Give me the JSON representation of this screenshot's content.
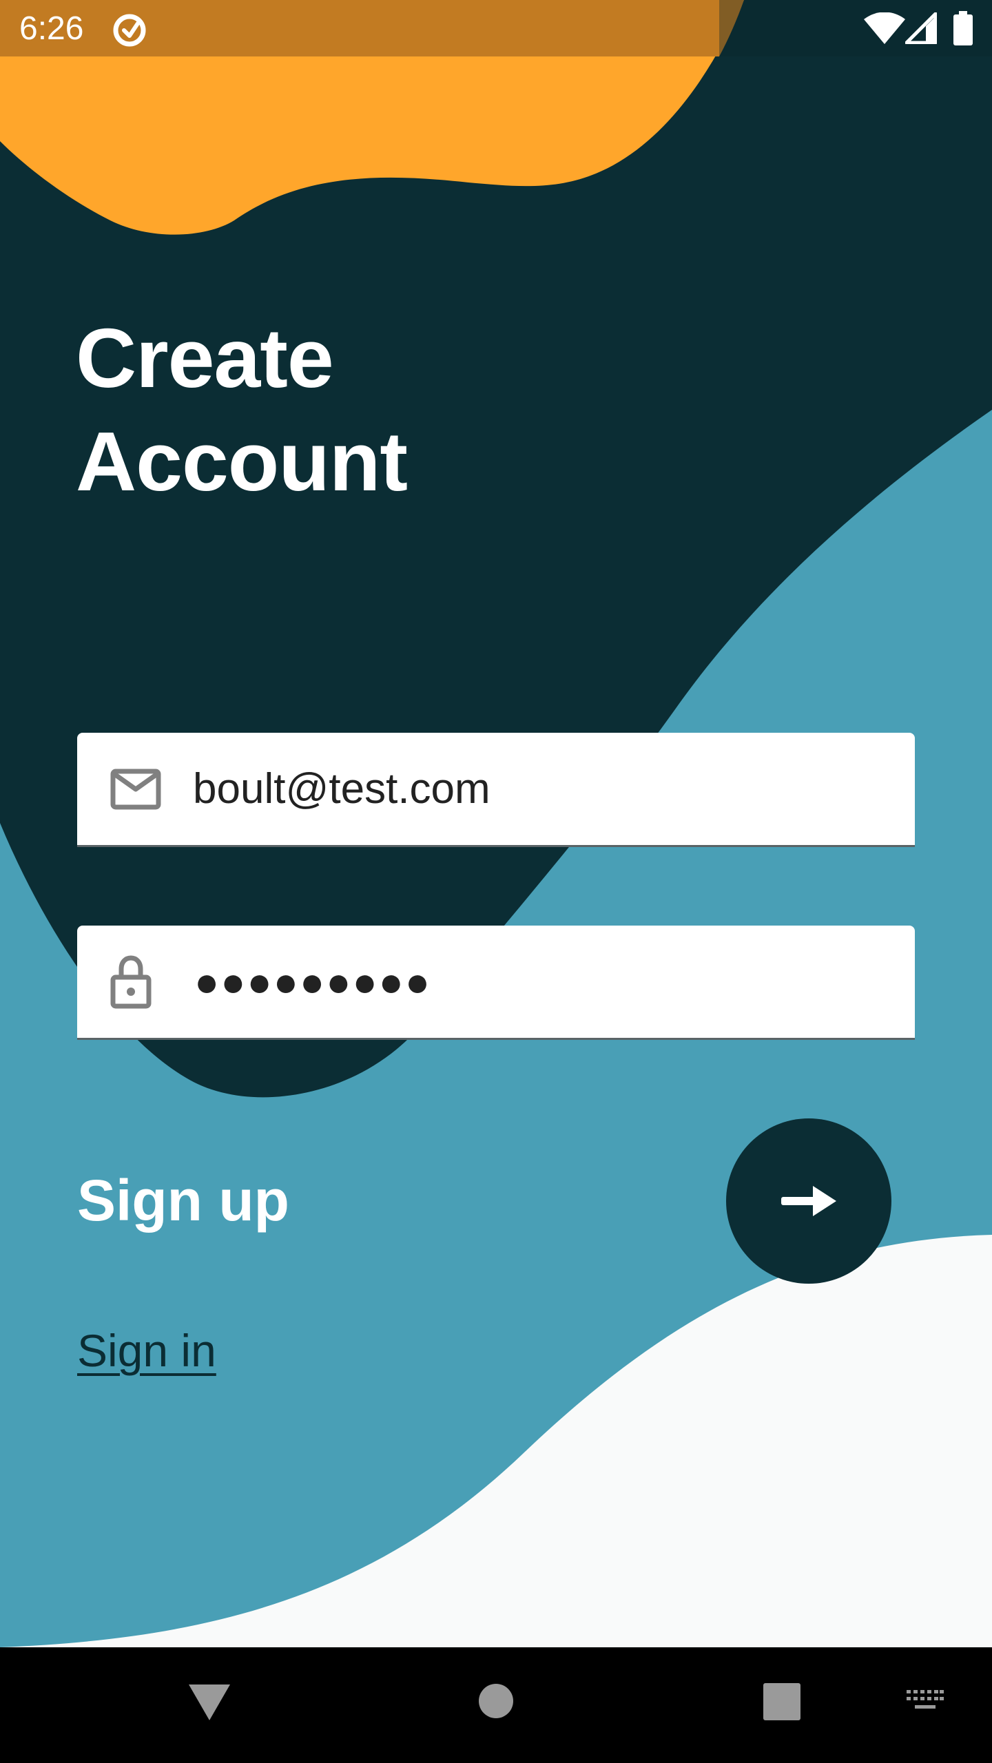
{
  "status_bar": {
    "time": "6:26",
    "icons": [
      "data-saver-icon",
      "wifi-icon",
      "signal-icon",
      "battery-icon"
    ]
  },
  "title": {
    "line1": "Create",
    "line2": "Account"
  },
  "form": {
    "email": {
      "icon": "mail-icon",
      "value": "boult@test.com"
    },
    "password": {
      "icon": "lock-icon",
      "masked_value": "●●●●●●●●●"
    }
  },
  "signup": {
    "label": "Sign up",
    "submit_icon": "arrow-right-icon"
  },
  "signin": {
    "label": "Sign in"
  },
  "nav_bar": {
    "buttons": [
      "back-icon",
      "home-icon",
      "recents-icon",
      "keyboard-icon"
    ]
  },
  "colors": {
    "dark_teal": "#0b2d34",
    "orange": "#ffa62b",
    "status_orange": "#c27b22",
    "blue": "#499fb6",
    "light": "#f9fafa"
  }
}
